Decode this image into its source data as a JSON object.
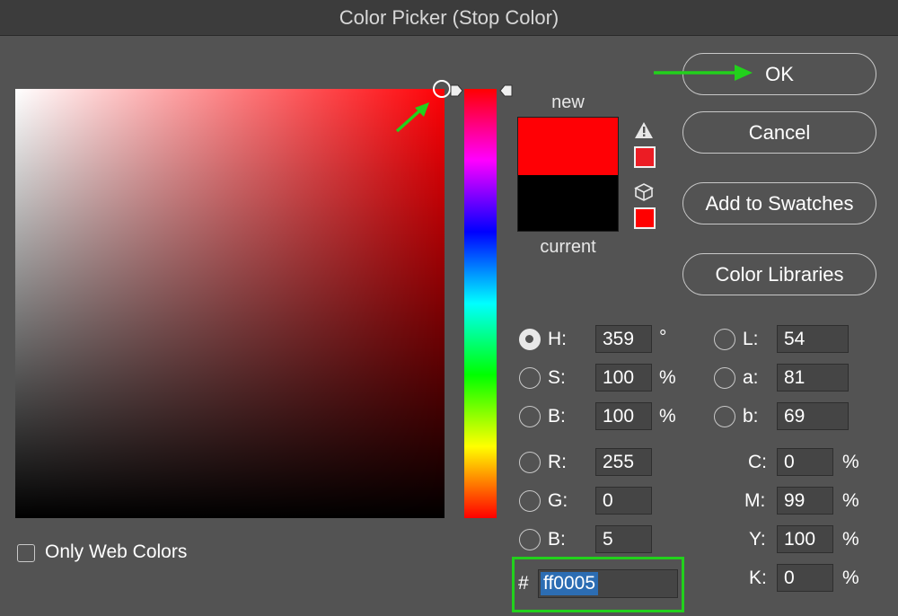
{
  "window": {
    "title": "Color Picker (Stop Color)"
  },
  "swatch": {
    "new_label": "new",
    "current_label": "current",
    "new_color": "#ff0005",
    "current_color": "#000000"
  },
  "buttons": {
    "ok": "OK",
    "cancel": "Cancel",
    "add_to_swatches": "Add to Swatches",
    "color_libraries": "Color Libraries"
  },
  "hsb": {
    "h": {
      "label": "H:",
      "value": "359",
      "unit": "°"
    },
    "s": {
      "label": "S:",
      "value": "100",
      "unit": "%"
    },
    "b": {
      "label": "B:",
      "value": "100",
      "unit": "%"
    },
    "selected": "H"
  },
  "rgb": {
    "r": {
      "label": "R:",
      "value": "255"
    },
    "g": {
      "label": "G:",
      "value": "0"
    },
    "b": {
      "label": "B:",
      "value": "5"
    }
  },
  "lab": {
    "l": {
      "label": "L:",
      "value": "54"
    },
    "a": {
      "label": "a:",
      "value": "81"
    },
    "b": {
      "label": "b:",
      "value": "69"
    }
  },
  "cmyk": {
    "c": {
      "label": "C:",
      "value": "0",
      "unit": "%"
    },
    "m": {
      "label": "M:",
      "value": "99",
      "unit": "%"
    },
    "y": {
      "label": "Y:",
      "value": "100",
      "unit": "%"
    },
    "k": {
      "label": "K:",
      "value": "0",
      "unit": "%"
    }
  },
  "hex": {
    "hash": "#",
    "value": "ff0005"
  },
  "web_colors": {
    "label": "Only Web Colors",
    "checked": false
  },
  "colors": {
    "accent_green": "#22d11c",
    "selection_blue": "#2c6db3"
  },
  "icons": {
    "gamut_warning": "warning-triangle-icon",
    "web_safe": "cube-icon"
  }
}
